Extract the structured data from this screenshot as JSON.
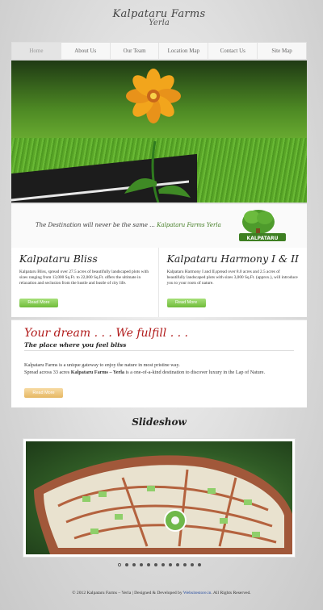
{
  "logo": {
    "line1": "Kalpataru Farms",
    "line2": "Yerla"
  },
  "nav": [
    {
      "label": "Home",
      "active": true
    },
    {
      "label": "About Us"
    },
    {
      "label": "Our Team"
    },
    {
      "label": "Location Map"
    },
    {
      "label": "Contact Us"
    },
    {
      "label": "Site Map"
    }
  ],
  "tagline": {
    "text": "The Destination will never be the same ...",
    "brand": "Kalpataru Farms Yerla",
    "badge": "KALPATARU"
  },
  "col1": {
    "title": "Kalpataru Bliss",
    "body": "Kalpataru Bliss, spread over 27.5 acres of beautifully landscaped plots with sizes ranging from 13,000 Sq.Ft. to 22,000 Sq.Ft. offers the ultimate in relaxation and seclusion from the hustle and bustle of city life.",
    "button": "Read More"
  },
  "col2": {
    "title": "Kalpataru Harmony I & II",
    "body": "Kalpataru Harmony I and II,spread over 8.0 acres and 2.5 acres of beautifully landscaped plots with sizes 3,000 Sq.Ft. (approx.), will introduce you to your roots of nature.",
    "button": "Read More"
  },
  "dream": {
    "title": "Your dream . . . We fulfill . . .",
    "subtitle": "The place where you feel bliss",
    "p1": "Kalpataru Farms is a unique gateway to enjoy the nature in most pristine way.",
    "p2a": "Spread across 33 acres ",
    "p2b": "Kalpataru Farms – Yerla",
    "p2c": " is a one-of-a-kind destination to discover luxury in the Lap of Nature.",
    "button": "Read More"
  },
  "slideshow": {
    "title": "Slideshow",
    "dot_count": 12,
    "active_dot": 0
  },
  "footer": {
    "pre": "© 2012 Kalpataru Farms – Yerla | Designed & Developed by ",
    "link": "Websitestore.in",
    "post": ". All Rights Reserved."
  }
}
